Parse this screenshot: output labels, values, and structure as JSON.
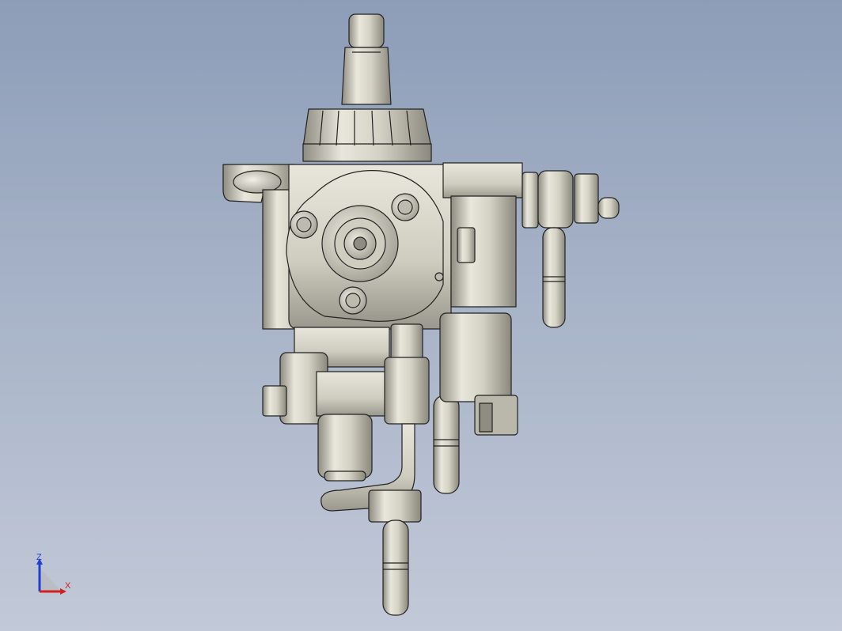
{
  "viewport": {
    "background_top": "#8d9db8",
    "background_bottom": "#c2c9d8"
  },
  "model": {
    "part_color": "#d8d6c8",
    "edge_color": "#222222"
  },
  "triad": {
    "z_label": "Z",
    "x_label": "X",
    "z_color": "#1f3fd0",
    "x_color": "#d02020"
  }
}
